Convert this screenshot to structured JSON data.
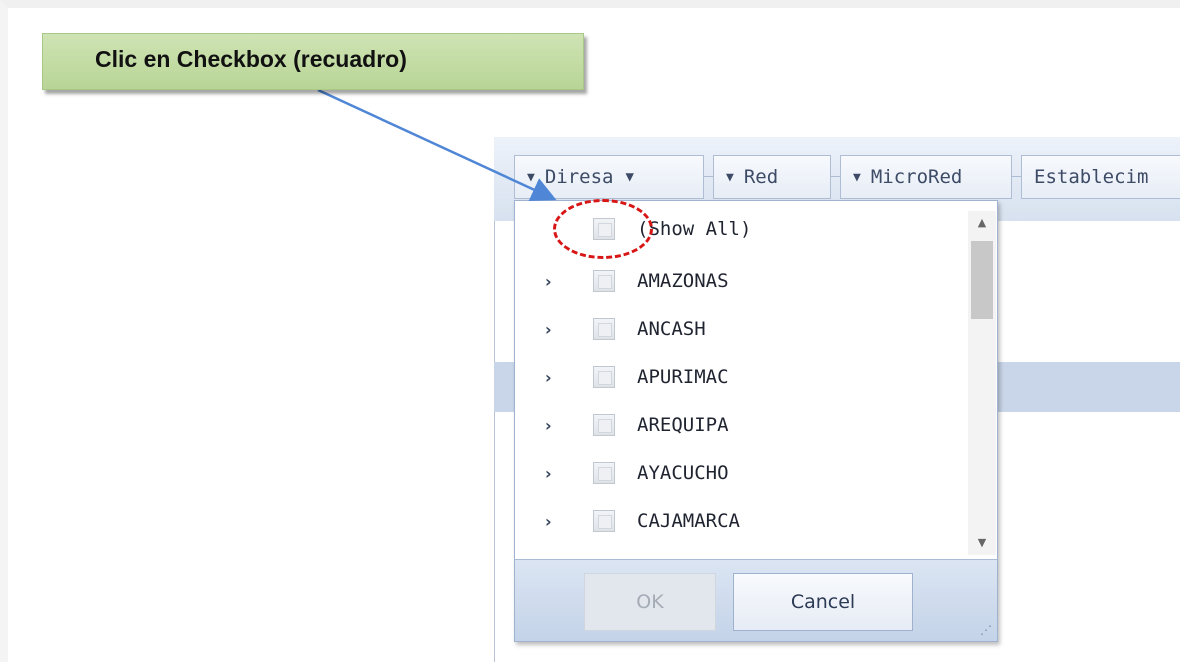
{
  "callout": {
    "text": "Clic en Checkbox (recuadro)"
  },
  "toolbar": {
    "fields": [
      {
        "label": "Diresa",
        "has_chevron": true,
        "has_filter": true
      },
      {
        "label": "Red",
        "has_chevron": true,
        "has_filter": false
      },
      {
        "label": "MicroRed",
        "has_chevron": true,
        "has_filter": false
      },
      {
        "label": "Establecim",
        "has_chevron": false,
        "has_filter": false
      }
    ],
    "chevron_icon": "chevron-down-icon",
    "filter_icon": "filter-icon"
  },
  "dropdown": {
    "show_all_label": "(Show All)",
    "items": [
      {
        "label": "AMAZONAS"
      },
      {
        "label": "ANCASH"
      },
      {
        "label": "APURIMAC"
      },
      {
        "label": "AREQUIPA"
      },
      {
        "label": "AYACUCHO"
      },
      {
        "label": "CAJAMARCA"
      }
    ],
    "ok_label": "OK",
    "cancel_label": "Cancel",
    "ok_enabled": false
  },
  "colors": {
    "accent": "#3d4b66",
    "highlight": "#d81616",
    "callout_bg": "#c4dca4",
    "arrow": "#4f86d6"
  }
}
